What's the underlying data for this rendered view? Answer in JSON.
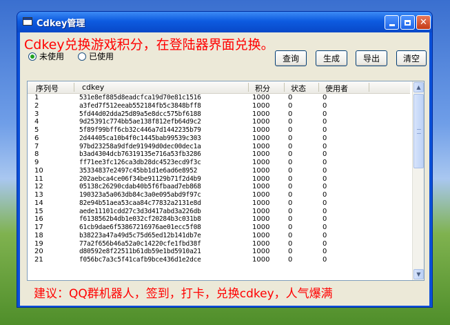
{
  "window": {
    "title": "Cdkey管理"
  },
  "headline": "Cdkey兑换游戏积分，在登陆器界面兑换。",
  "filters": [
    {
      "label": "未使用",
      "checked": true
    },
    {
      "label": "已使用",
      "checked": false
    }
  ],
  "buttons": {
    "query": "查询",
    "generate": "生成",
    "export": "导出",
    "clear": "清空"
  },
  "table": {
    "columns": [
      "序列号",
      "cdkey",
      "积分",
      "状态",
      "使用者"
    ],
    "rows": [
      [
        "1",
        "531e8ef885d8eadcfca19d70e81c1516",
        "1000",
        "0",
        "0"
      ],
      [
        "2",
        "a3fed7f512eeab552184fb5c3848bff8",
        "1000",
        "0",
        "0"
      ],
      [
        "3",
        "5fd44d02dda25d89a5e8dcc575bf6188",
        "1000",
        "0",
        "0"
      ],
      [
        "4",
        "9d25391c774bb5ae138f812efb64d9c2",
        "1000",
        "0",
        "0"
      ],
      [
        "5",
        "5f89f99bff6cb32c446a7d1442235b79",
        "1000",
        "0",
        "0"
      ],
      [
        "6",
        "2d44405ca10b4f0c1445bab99539c303",
        "1000",
        "0",
        "0"
      ],
      [
        "7",
        "97bd23258a9dfde91949d0dec00dec1a",
        "1000",
        "0",
        "0"
      ],
      [
        "8",
        "b3ad4304dcb76319135e716a53fb3286",
        "1000",
        "0",
        "0"
      ],
      [
        "9",
        "ff71ee3fc126ca3db28dc4523ecd9f3c",
        "1000",
        "0",
        "0"
      ],
      [
        "10",
        "35334837e2497c45bb1d1e6ad6e8952",
        "1000",
        "0",
        "0"
      ],
      [
        "11",
        "202aebca4ce06f34be91129b71f2d4b9",
        "1000",
        "0",
        "0"
      ],
      [
        "12",
        "05138c26290cdab40b5f6fbaad7eb868",
        "1000",
        "0",
        "0"
      ],
      [
        "13",
        "190323a5a063db84c3a0e095abd9f97c",
        "1000",
        "0",
        "0"
      ],
      [
        "14",
        "82e94b51aea53caa84c77832a2131e8d",
        "1000",
        "0",
        "0"
      ],
      [
        "15",
        "aede11101cdd27c3d3d417abd3a226db",
        "1000",
        "0",
        "0"
      ],
      [
        "16",
        "f6138562b4db1e032cf20284b3c031b8",
        "1000",
        "0",
        "0"
      ],
      [
        "17",
        "61cb9dae6f53867216976ae01ecc5f08",
        "1000",
        "0",
        "0"
      ],
      [
        "18",
        "b38223a47a49d5c75d65ed12b141db7e",
        "1000",
        "0",
        "0"
      ],
      [
        "19",
        "77a2f656b46a52a0c14220cfe1fbd38f",
        "1000",
        "0",
        "0"
      ],
      [
        "20",
        "d80592e8f22511b61db59e1bd5910a21",
        "1000",
        "0",
        "0"
      ],
      [
        "21",
        "f056bc7a3c5f41cafb9bce436d1e2dce",
        "1000",
        "0",
        "0"
      ]
    ]
  },
  "footer_note": "建议：QQ群机器人，签到，打卡，兑换cdkey，人气爆满"
}
